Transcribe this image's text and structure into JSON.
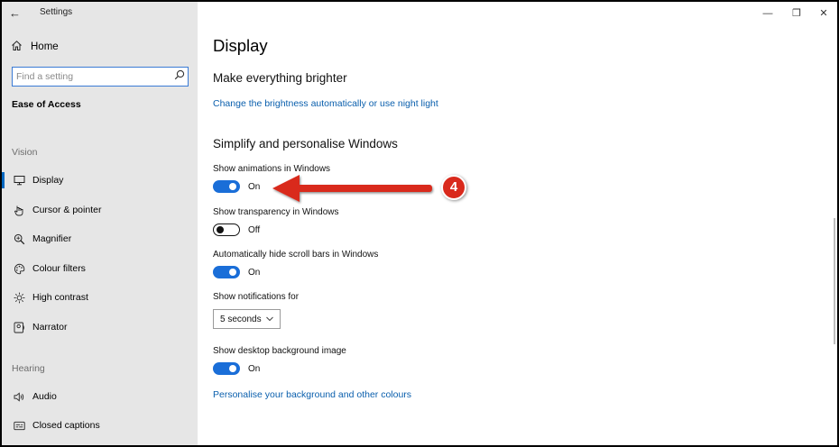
{
  "titlebar": {
    "back_glyph": "←",
    "title": "Settings",
    "min_glyph": "—",
    "max_glyph": "❐",
    "close_glyph": "✕"
  },
  "sidebar": {
    "home": {
      "icon": "home-icon",
      "label": "Home"
    },
    "search": {
      "placeholder": "Find a setting",
      "value": "",
      "icon": "search-icon"
    },
    "section_title": "Ease of Access",
    "groups": [
      {
        "label": "Vision",
        "items": [
          {
            "label": "Display",
            "icon": "monitor-icon",
            "active": true
          },
          {
            "label": "Cursor & pointer",
            "icon": "cursor-icon",
            "active": false
          },
          {
            "label": "Magnifier",
            "icon": "magnifier-icon",
            "active": false
          },
          {
            "label": "Colour filters",
            "icon": "palette-icon",
            "active": false
          },
          {
            "label": "High contrast",
            "icon": "sun-icon",
            "active": false
          },
          {
            "label": "Narrator",
            "icon": "narrator-icon",
            "active": false
          }
        ]
      },
      {
        "label": "Hearing",
        "items": [
          {
            "label": "Audio",
            "icon": "speaker-icon",
            "active": false
          },
          {
            "label": "Closed captions",
            "icon": "captions-icon",
            "active": false
          }
        ]
      }
    ]
  },
  "main": {
    "title": "Display",
    "brighter": {
      "heading": "Make everything brighter",
      "link": "Change the brightness automatically or use night light"
    },
    "simplify": {
      "heading": "Simplify and personalise Windows",
      "settings": [
        {
          "label": "Show animations in Windows",
          "on": true,
          "state": "On"
        },
        {
          "label": "Show transparency in Windows",
          "on": false,
          "state": "Off"
        },
        {
          "label": "Automatically hide scroll bars in Windows",
          "on": true,
          "state": "On"
        }
      ],
      "notifications": {
        "label": "Show notifications for",
        "value": "5 seconds"
      },
      "background": {
        "label": "Show desktop background image",
        "on": true,
        "state": "On"
      },
      "link": "Personalise your background and other colours"
    }
  },
  "annotation": {
    "step": "4",
    "arrow_color": "#d9291c"
  },
  "colors": {
    "accent": "#1a6ed8",
    "link": "#0a5fad",
    "sidebar_bg": "#e6e6e6"
  }
}
